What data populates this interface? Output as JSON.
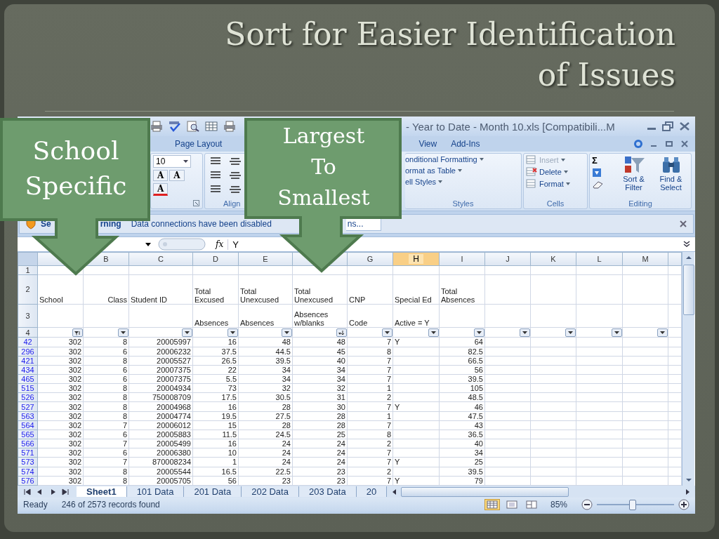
{
  "slide": {
    "title_lines": [
      "Sort for Easier Identification",
      "of Issues"
    ]
  },
  "callouts": [
    {
      "lines": [
        "School",
        "Specific"
      ]
    },
    {
      "lines": [
        "Largest",
        "To",
        "Smallest"
      ]
    }
  ],
  "excel": {
    "title": "- Year to Date - Month 10.xls  [Compatibili...M",
    "tabs": [
      {
        "label": "Page Layout",
        "selected": false
      },
      {
        "label": "View",
        "selected": false
      },
      {
        "label": "Add-Ins",
        "selected": false
      }
    ],
    "font_size": "10",
    "font_buttons": [
      "A",
      "A"
    ],
    "font_color_button": "A",
    "alignment_group": "Align",
    "styles_items": [
      "onditional Formatting",
      "ormat as Table",
      "ell Styles"
    ],
    "styles_group": "Styles",
    "cells_items": [
      {
        "label": "Insert",
        "disabled": true
      },
      {
        "label": "Delete",
        "disabled": false
      },
      {
        "label": "Format",
        "disabled": false
      }
    ],
    "cells_group": "Cells",
    "sum_symbol": "Σ",
    "editing_buttons": [
      "Sort & Filter",
      "Find & Select"
    ],
    "editing_group": "Editing",
    "security_bar": {
      "fragments": [
        "Se",
        "rning"
      ],
      "message": "Data connections have been disabled",
      "button": "ns..."
    },
    "formula_bar": {
      "fx": "fx",
      "value": "Y"
    },
    "columns": [
      {
        "filtered": true,
        "sorted": false
      },
      {
        "letter": "B",
        "selected": false,
        "filtered": false,
        "sorted": false
      },
      {
        "letter": "C",
        "selected": false,
        "filtered": false,
        "sorted": false
      },
      {
        "letter": "D",
        "selected": false,
        "filtered": false,
        "sorted": false
      },
      {
        "letter": "E",
        "selected": false,
        "filtered": false,
        "sorted": false
      },
      {
        "filtered": false,
        "sorted": true
      },
      {
        "letter": "G",
        "selected": false,
        "filtered": false,
        "sorted": false
      },
      {
        "letter": "H",
        "selected": true,
        "filtered": false,
        "sorted": false
      },
      {
        "letter": "I",
        "selected": false,
        "filtered": false,
        "sorted": false
      },
      {
        "letter": "J",
        "selected": false,
        "filtered": false,
        "sorted": false
      },
      {
        "letter": "K",
        "selected": false,
        "filtered": false,
        "sorted": false
      },
      {
        "letter": "L",
        "selected": false,
        "filtered": false,
        "sorted": false
      },
      {
        "letter": "M",
        "selected": false,
        "filtered": false,
        "sorted": false
      }
    ],
    "header_rows": [
      {
        "number": "1",
        "cells": []
      },
      {
        "number": "2",
        "cells": [
          "School",
          "Class",
          "Student ID",
          "Total Excused",
          "Total Unexcused",
          "Total Unexcused",
          "CNP",
          "Special Ed",
          "Total Absences"
        ]
      },
      {
        "number": "3",
        "cells": [
          null,
          null,
          null,
          "Absences",
          "Absences",
          "Absences w/blanks",
          "Code",
          "Active = Y",
          null
        ]
      }
    ],
    "filter_row": {
      "number": "4"
    },
    "rows": [
      {
        "number": "42",
        "cells": [
          "302",
          "8",
          "20005997",
          "16",
          "48",
          "48",
          "7",
          "Y",
          "64"
        ]
      },
      {
        "number": "296",
        "cells": [
          "302",
          "6",
          "20006232",
          "37.5",
          "44.5",
          "45",
          "8",
          null,
          "82.5"
        ]
      },
      {
        "number": "421",
        "cells": [
          "302",
          "8",
          "20005527",
          "26.5",
          "39.5",
          "40",
          "7",
          null,
          "66.5"
        ]
      },
      {
        "number": "434",
        "cells": [
          "302",
          "6",
          "20007375",
          "22",
          "34",
          "34",
          "7",
          null,
          "56"
        ]
      },
      {
        "number": "465",
        "cells": [
          "302",
          "6",
          "20007375",
          "5.5",
          "34",
          "34",
          "7",
          null,
          "39.5"
        ]
      },
      {
        "number": "515",
        "cells": [
          "302",
          "8",
          "20004934",
          "73",
          "32",
          "32",
          "1",
          null,
          "105"
        ]
      },
      {
        "number": "526",
        "cells": [
          "302",
          "8",
          "750008709",
          "17.5",
          "30.5",
          "31",
          "2",
          null,
          "48.5"
        ]
      },
      {
        "number": "527",
        "cells": [
          "302",
          "8",
          "20004968",
          "16",
          "28",
          "30",
          "7",
          "Y",
          "46"
        ]
      },
      {
        "number": "563",
        "cells": [
          "302",
          "8",
          "20004774",
          "19.5",
          "27.5",
          "28",
          "1",
          null,
          "47.5"
        ]
      },
      {
        "number": "564",
        "cells": [
          "302",
          "7",
          "20006012",
          "15",
          "28",
          "28",
          "7",
          null,
          "43"
        ]
      },
      {
        "number": "565",
        "cells": [
          "302",
          "6",
          "20005883",
          "11.5",
          "24.5",
          "25",
          "8",
          null,
          "36.5"
        ]
      },
      {
        "number": "566",
        "cells": [
          "302",
          "7",
          "20005499",
          "16",
          "24",
          "24",
          "2",
          null,
          "40"
        ]
      },
      {
        "number": "571",
        "cells": [
          "302",
          "6",
          "20006380",
          "10",
          "24",
          "24",
          "7",
          null,
          "34"
        ]
      },
      {
        "number": "573",
        "cells": [
          "302",
          "7",
          "870008234",
          "1",
          "24",
          "24",
          "7",
          "Y",
          "25"
        ]
      },
      {
        "number": "574",
        "cells": [
          "302",
          "8",
          "20005544",
          "16.5",
          "22.5",
          "23",
          "2",
          null,
          "39.5"
        ]
      },
      {
        "number": "576",
        "cells": [
          "302",
          "8",
          "20005705",
          "56",
          "23",
          "23",
          "7",
          "Y",
          "79"
        ]
      }
    ],
    "sheet_tabs": [
      {
        "label": "Sheet1",
        "selected": true
      },
      {
        "label": "101 Data",
        "selected": false
      },
      {
        "label": "201 Data",
        "selected": false
      },
      {
        "label": "202 Data",
        "selected": false
      },
      {
        "label": "203 Data",
        "selected": false
      },
      {
        "label": "20",
        "selected": false
      }
    ],
    "status": {
      "ready": "Ready",
      "records": "246 of 2573 records found",
      "views": [
        {
          "selected": true
        },
        {
          "selected": false
        },
        {
          "selected": false
        }
      ],
      "zoom": "85%",
      "zoom_slider": {
        "level": 0.45
      }
    }
  }
}
